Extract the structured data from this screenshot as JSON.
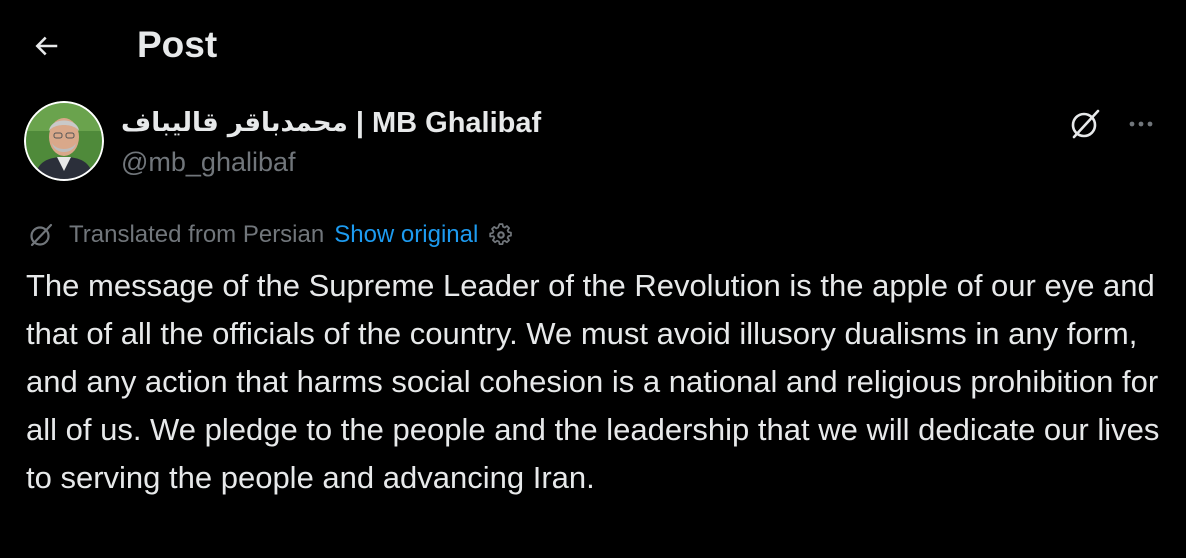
{
  "header": {
    "title": "Post",
    "back_icon": "arrow-left-icon"
  },
  "author": {
    "name_latin": "| MB Ghalibaf",
    "name_persian": "محمدباقر قالیباف",
    "handle": "@mb_ghalibaf",
    "avatar": "avatar-image"
  },
  "actions": {
    "grok_icon": "grok-icon",
    "more_icon": "more-dots-icon"
  },
  "translation": {
    "label": "Translated from Persian",
    "show_original": "Show original",
    "settings_icon": "gear-icon"
  },
  "post": {
    "text": "The message of the Supreme Leader of the Revolution is the apple of our eye and that of all the officials of the country. We must avoid illusory dualisms in any form, and any action that harms social cohesion is a national and religious prohibition for all of us. We pledge to the people and the leadership that we will dedicate our lives to serving the people and advancing Iran."
  },
  "colors": {
    "background": "#000000",
    "text_primary": "#e7e9ea",
    "text_secondary": "#71767b",
    "link": "#1d9bf0"
  }
}
